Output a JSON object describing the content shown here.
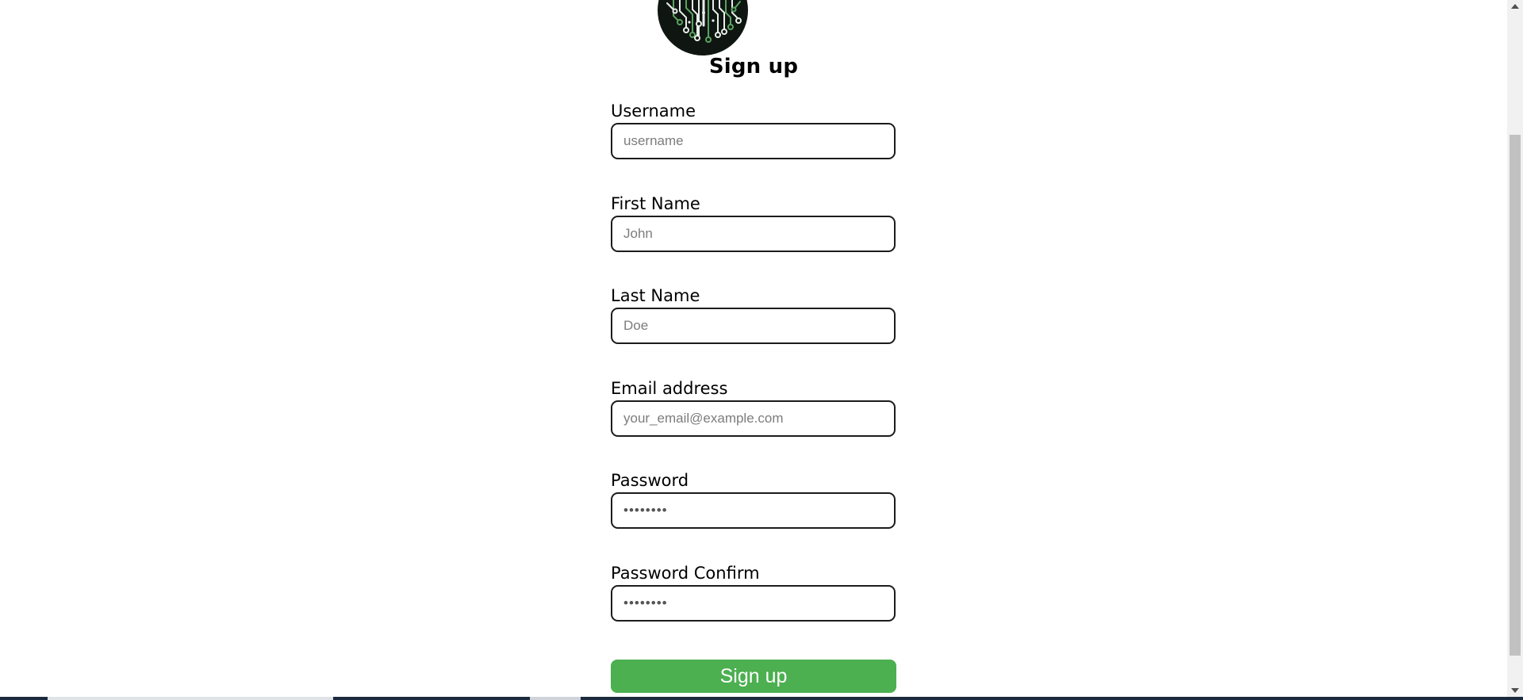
{
  "page": {
    "title": "Sign up"
  },
  "form": {
    "fields": [
      {
        "label": "Username",
        "placeholder": "username",
        "type": "text"
      },
      {
        "label": "First Name",
        "placeholder": "John",
        "type": "text"
      },
      {
        "label": "Last Name",
        "placeholder": "Doe",
        "type": "text"
      },
      {
        "label": "Email address",
        "placeholder": "your_email@example.com",
        "type": "email"
      },
      {
        "label": "Password",
        "placeholder": "••••••••",
        "type": "password"
      },
      {
        "label": "Password Confirm",
        "placeholder": "••••••••",
        "type": "password"
      }
    ],
    "submit_label": "Sign up"
  },
  "icons": {
    "logo": "circuit-board-logo-icon",
    "scroll_up": "chevron-up-icon",
    "scroll_down": "chevron-down-icon"
  },
  "colors": {
    "submit_background": "#4caf50",
    "submit_text": "#ffffff",
    "input_border": "#1c1c1c",
    "logo_background": "#0f1612",
    "logo_trace_light": "#e8efe9",
    "logo_trace_green": "#5aa35f"
  }
}
